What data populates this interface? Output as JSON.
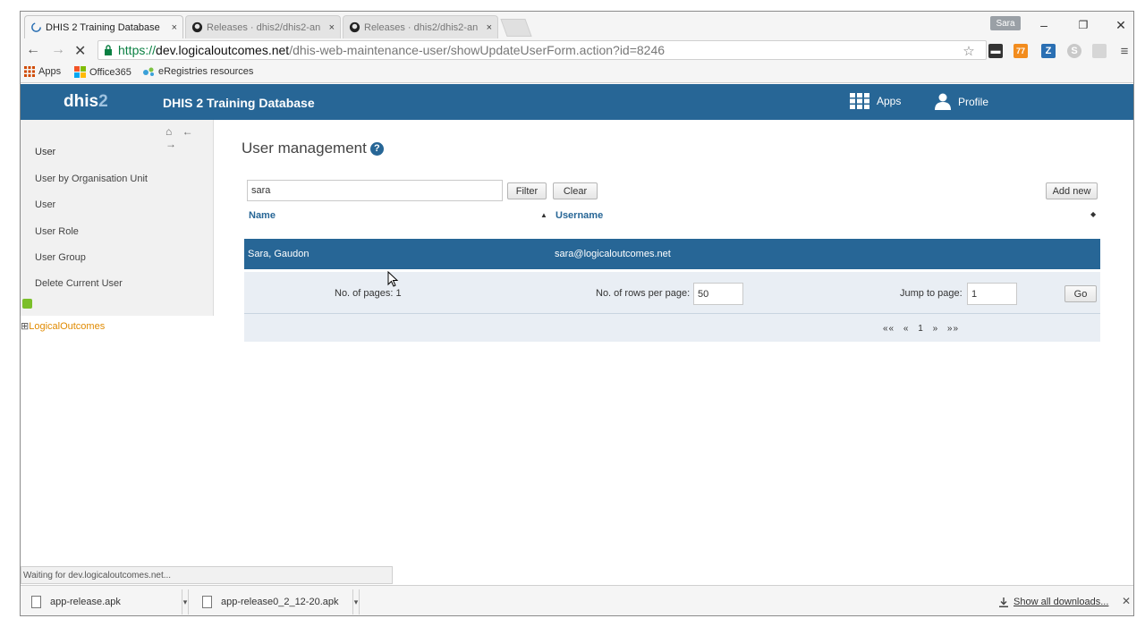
{
  "browser": {
    "tabs": [
      {
        "label": "DHIS 2 Training Database",
        "close": "×"
      },
      {
        "label": "Releases · dhis2/dhis2-an",
        "close": "×"
      },
      {
        "label": "Releases · dhis2/dhis2-an",
        "close": "×"
      }
    ],
    "user_chip": "Sara",
    "window_buttons": {
      "minimize": "–",
      "restore": "❐",
      "close": "✕"
    },
    "nav": {
      "back": "←",
      "forward": "→",
      "stop": "✕"
    },
    "url": {
      "scheme": "https://",
      "host": "dev.logicaloutcomes.net",
      "path": "/dhis-web-maintenance-user/showUpdateUserForm.action?id=8246"
    },
    "bookmarks": [
      {
        "label": "Apps",
        "icon": "apps-grid-icon"
      },
      {
        "label": "Office365",
        "icon": "office-icon"
      },
      {
        "label": "eRegistries resources",
        "icon": "eregistries-icon"
      }
    ],
    "extensions": [
      {
        "icon": "bookmark-star-icon"
      },
      {
        "icon": "ext-dark-icon",
        "color": "#333333"
      },
      {
        "icon": "rss-icon",
        "color": "#f28c1e",
        "badge": "77"
      },
      {
        "icon": "zotero-icon",
        "color": "#2a6fb3",
        "text": "Z"
      },
      {
        "icon": "skype-icon",
        "color": "#bbbbbb"
      },
      {
        "icon": "cast-icon",
        "color": "#bbbbbb"
      },
      {
        "icon": "menu-icon"
      }
    ]
  },
  "header": {
    "logo_main": "dhis",
    "logo_num": "2",
    "title": "DHIS 2 Training Database",
    "apps_label": "Apps",
    "profile_label": "Profile",
    "color": "#276696"
  },
  "sidebar": {
    "nav_arrows": "⌂ ← →",
    "section_title": "User",
    "items": [
      {
        "label": "User by Organisation Unit"
      },
      {
        "label": "User"
      },
      {
        "label": "User Role"
      },
      {
        "label": "User Group"
      },
      {
        "label": "Delete Current User"
      }
    ],
    "tree_root_expander": "⊞",
    "tree_root": "LogicalOutcomes"
  },
  "main": {
    "title": "User management",
    "help": "?",
    "filter_value": "sara",
    "filter_button": "Filter",
    "clear_button": "Clear",
    "add_button": "Add new",
    "columns": {
      "name": "Name",
      "sort_indicator": "▲",
      "username": "Username",
      "sort_both": "◆"
    },
    "rows": [
      {
        "name": "Sara, Gaudon",
        "username": "sara@logicaloutcomes.net",
        "selected": true
      }
    ],
    "pager": {
      "pages_label": "No. of pages: 1",
      "rows_label": "No. of rows per page:",
      "rows_value": "50",
      "jump_label": "Jump to page:",
      "jump_value": "1",
      "go_button": "Go",
      "links": "«« « 1 » »»"
    }
  },
  "status": "Waiting for dev.logicaloutcomes.net...",
  "downloads": {
    "items": [
      {
        "name": "app-release.apk"
      },
      {
        "name": "app-release0_2_12-20.apk"
      }
    ],
    "menu_caret": "▾",
    "show_all": "Show all downloads...",
    "close": "✕"
  }
}
